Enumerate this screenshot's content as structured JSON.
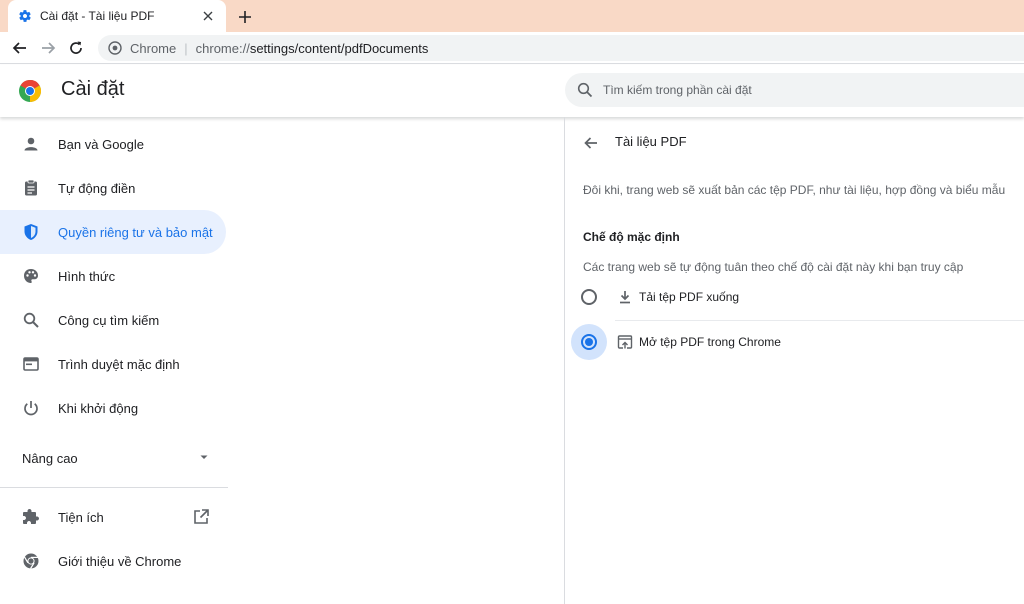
{
  "tab": {
    "title": "Cài đặt - Tài liệu PDF"
  },
  "omnibox": {
    "site": "Chrome",
    "url_scheme": "chrome://",
    "url_path": "settings/content/pdfDocuments"
  },
  "header": {
    "title": "Cài đặt",
    "search_placeholder": "Tìm kiếm trong phần cài đặt"
  },
  "sidebar": {
    "items": [
      {
        "label": "Bạn và Google",
        "icon": "person-icon"
      },
      {
        "label": "Tự động điền",
        "icon": "clipboard-icon"
      },
      {
        "label": "Quyền riêng tư và bảo mật",
        "icon": "shield-icon",
        "active": true
      },
      {
        "label": "Hình thức",
        "icon": "palette-icon"
      },
      {
        "label": "Công cụ tìm kiếm",
        "icon": "search-icon"
      },
      {
        "label": "Trình duyệt mặc định",
        "icon": "browser-icon"
      },
      {
        "label": "Khi khởi động",
        "icon": "power-icon"
      }
    ],
    "advanced": "Nâng cao",
    "extensions": "Tiện ích",
    "about": "Giới thiệu về Chrome"
  },
  "main": {
    "title": "Tài liệu PDF",
    "description": "Đôi khi, trang web sẽ xuất bản các tệp PDF, như tài liệu, hợp đồng và biểu mẫu",
    "section_title": "Chế độ mặc định",
    "section_description": "Các trang web sẽ tự động tuân theo chế độ cài đặt này khi bạn truy cập",
    "options": [
      {
        "label": "Tải tệp PDF xuống",
        "checked": false,
        "icon": "download-icon"
      },
      {
        "label": "Mở tệp PDF trong Chrome",
        "checked": true,
        "icon": "open-in-browser-icon"
      }
    ]
  },
  "colors": {
    "accent": "#1a73e8",
    "active_bg": "#e8f0fe",
    "tabstrip": "#f9d9c6"
  }
}
